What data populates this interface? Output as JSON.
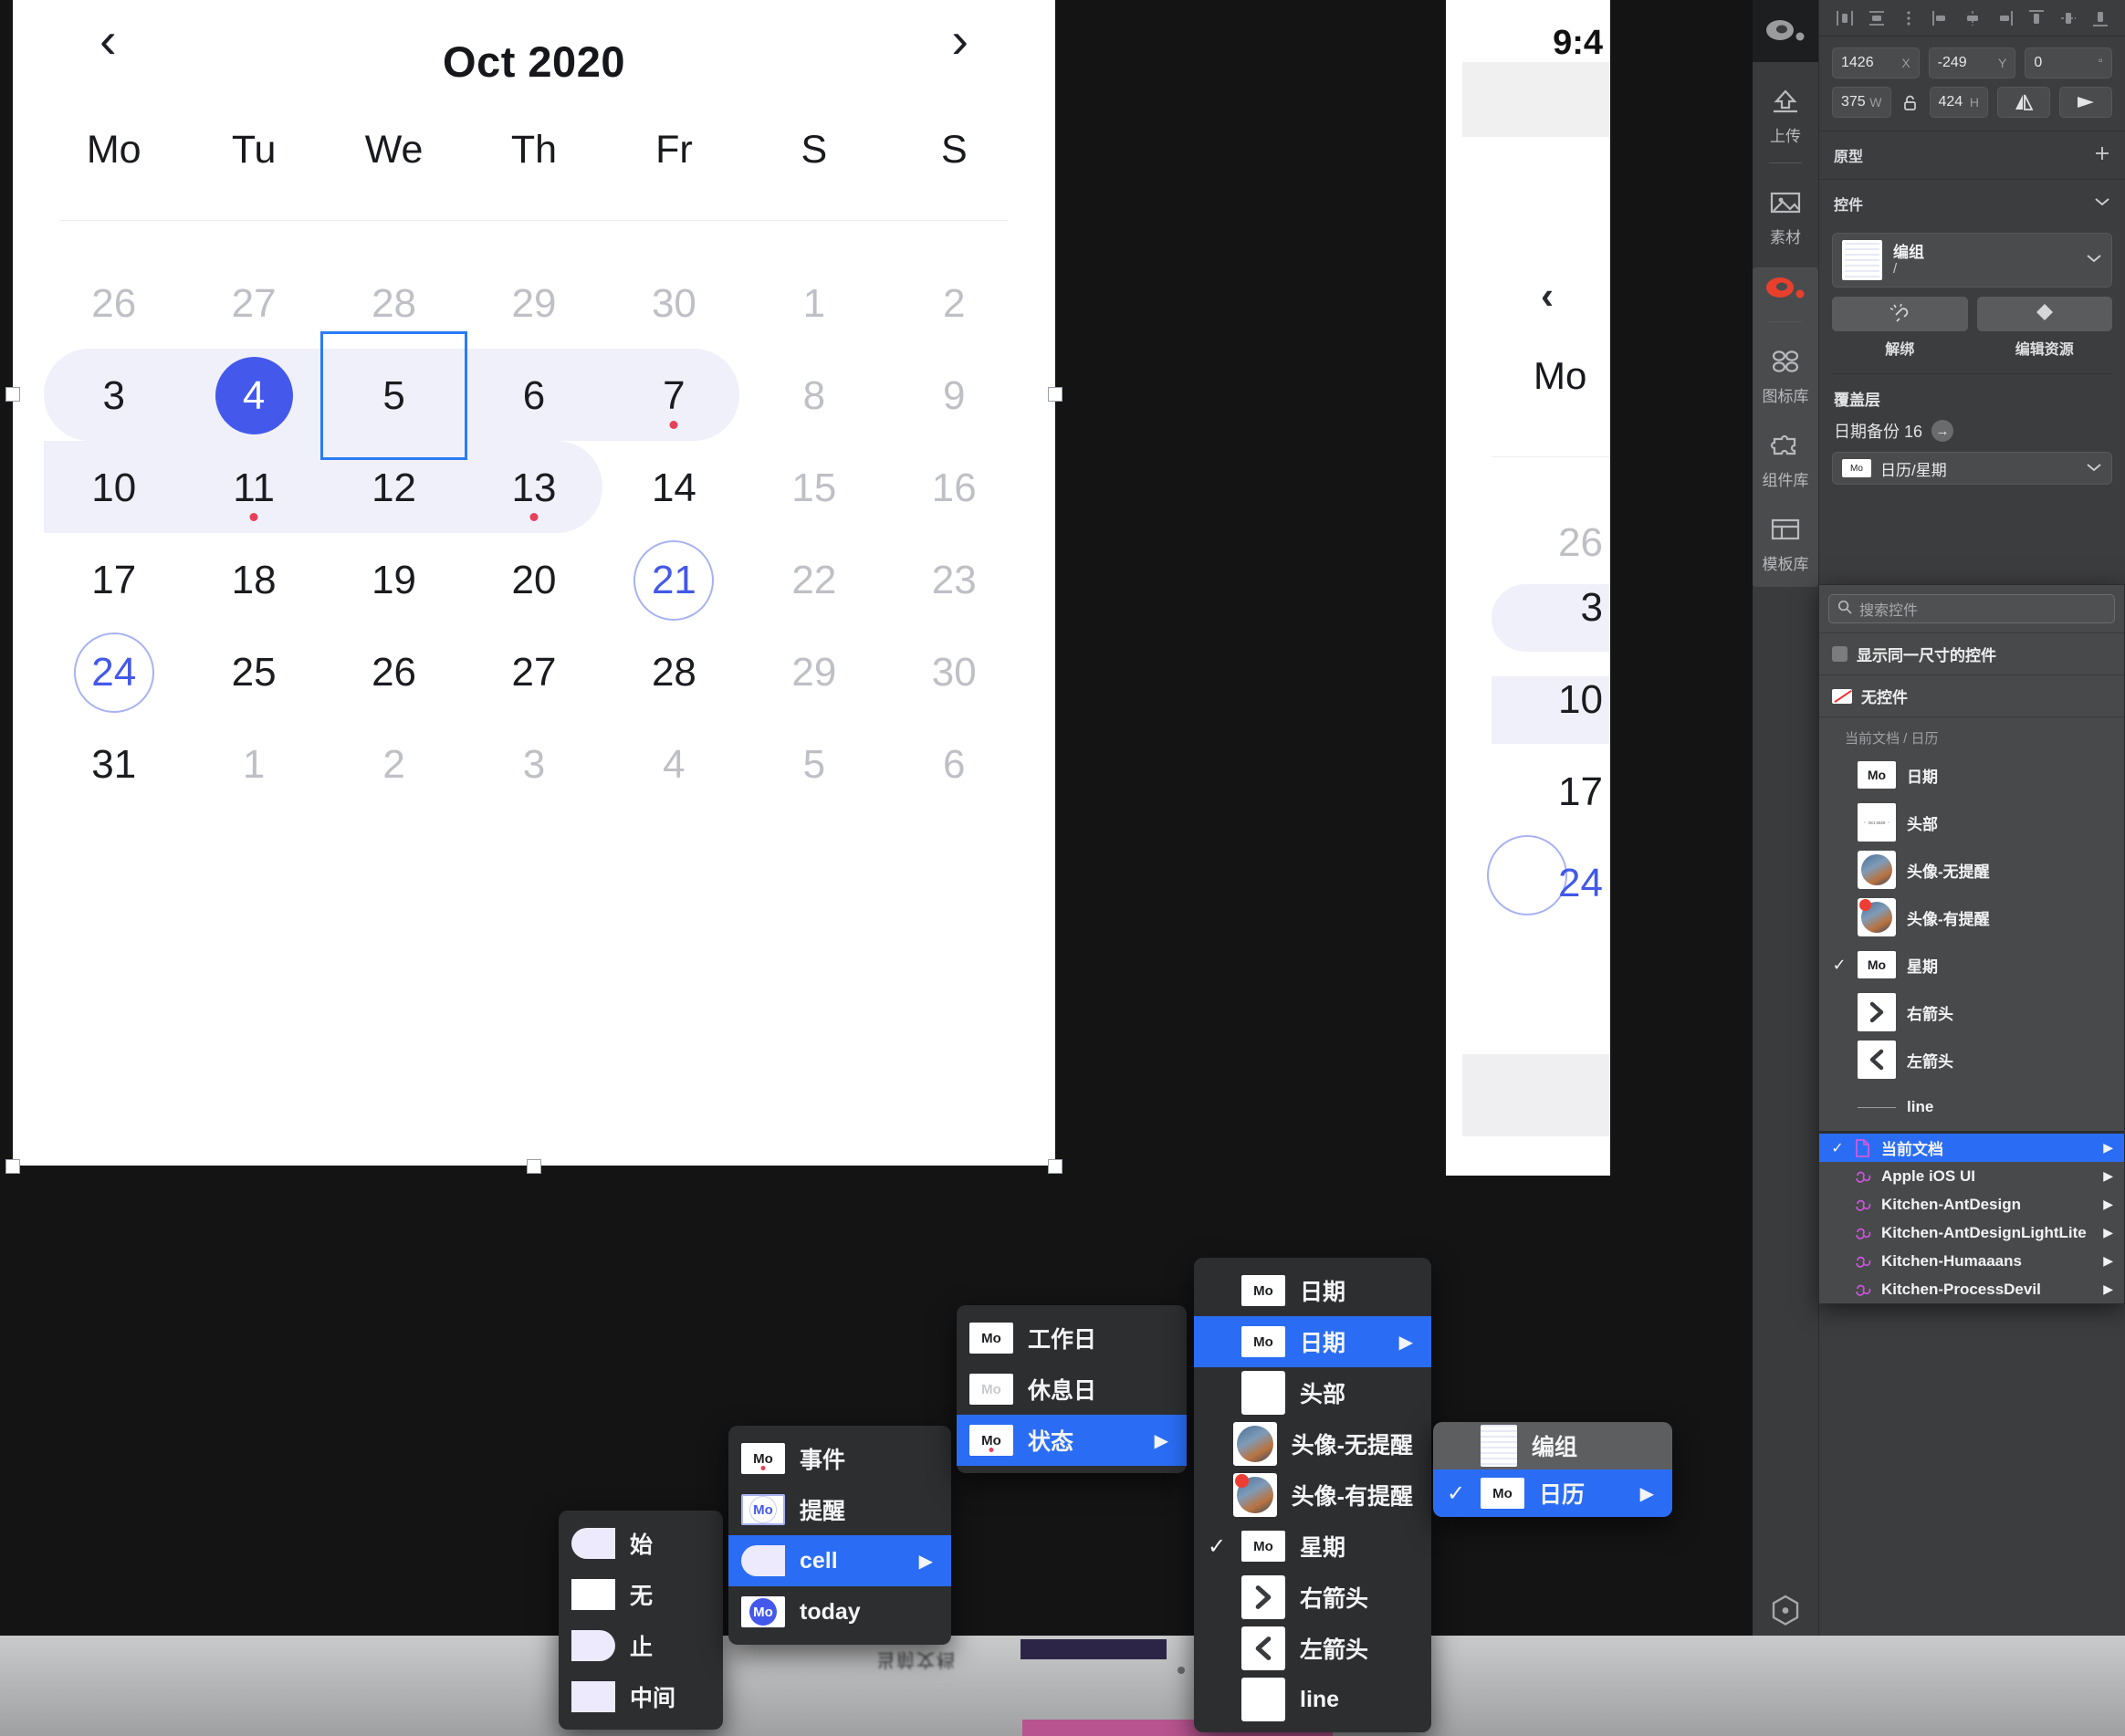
{
  "app": {
    "rail": {
      "logo_icon": "mockplus-logo-icon",
      "items": [
        {
          "label": "上传",
          "icon": "upload-icon"
        },
        {
          "label": "素材",
          "icon": "image-icon"
        },
        {
          "label": "",
          "icon": "mockplus-red-logo-icon"
        },
        {
          "label": "图标库",
          "icon": "icons-library-icon"
        },
        {
          "label": "组件库",
          "icon": "puzzle-icon"
        },
        {
          "label": "模板库",
          "icon": "template-icon"
        }
      ]
    },
    "toolbar_icons": [
      "align-left-icon",
      "align-center-horizontal-icon",
      "distribute-vertical-icon",
      "align-left-edge-icon",
      "align-center-icon",
      "align-right-edge-icon",
      "align-top-icon",
      "align-middle-icon",
      "align-bottom-icon"
    ],
    "transform": {
      "x": {
        "value": "1426",
        "unit": "X"
      },
      "y": {
        "value": "-249",
        "unit": "Y"
      },
      "rotation": {
        "value": "0",
        "unit": "°"
      },
      "w": {
        "value": "375",
        "unit": "W"
      },
      "h": {
        "value": "424",
        "unit": "H"
      },
      "lock_icon": "unlock-icon",
      "flip_h_icon": "flip-horizontal-icon",
      "flip_v_icon": "flip-vertical-icon"
    },
    "sections": {
      "prototype": {
        "title": "原型",
        "add_icon": "plus-icon"
      },
      "component": {
        "title": "控件",
        "collapse_icon": "chevron-down-icon"
      }
    },
    "component_card": {
      "name": "编组",
      "path": "/",
      "thumb_icon": "calendar-thumb-icon",
      "chevron_icon": "chevron-down-icon"
    },
    "component_buttons": [
      {
        "label": "解绑",
        "icon": "unlink-icon"
      },
      {
        "label": "编辑资源",
        "icon": "diamond-icon"
      }
    ],
    "overlay": {
      "title": "覆盖层",
      "item_label": "日期备份 16",
      "go_icon": "arrow-right-icon",
      "select_value": "日历/星期",
      "select_badge": "Mo",
      "chevron_icon": "chevron-down-icon"
    },
    "popover": {
      "search_placeholder": "搜索控件",
      "search_icon": "search-icon",
      "same_size_label": "显示同一尺寸的控件",
      "no_component_label": "无控件",
      "group_label": "当前文档 / 日历",
      "items": [
        {
          "label": "日期",
          "badge": "Mo",
          "thumb": "mo-badge",
          "checked": false
        },
        {
          "label": "头部",
          "badge": "",
          "thumb": "header-thumb",
          "checked": false
        },
        {
          "label": "头像-无提醒",
          "badge": "",
          "thumb": "avatar",
          "checked": false
        },
        {
          "label": "头像-有提醒",
          "badge": "",
          "thumb": "avatar-dot",
          "checked": false
        },
        {
          "label": "星期",
          "badge": "Mo",
          "thumb": "mo-badge",
          "checked": true
        },
        {
          "label": "右箭头",
          "badge": "",
          "thumb": "arrow-right",
          "checked": false
        },
        {
          "label": "左箭头",
          "badge": "",
          "thumb": "arrow-left",
          "checked": false
        },
        {
          "label": "line",
          "badge": "",
          "thumb": "line",
          "checked": false
        }
      ],
      "documents": [
        {
          "label": "当前文档",
          "icon": "document-icon",
          "checked": true,
          "selected": true
        },
        {
          "label": "Apple iOS UI",
          "icon": "library-icon",
          "checked": false,
          "selected": false
        },
        {
          "label": "Kitchen-AntDesign",
          "icon": "library-icon",
          "checked": false,
          "selected": false
        },
        {
          "label": "Kitchen-AntDesignLightLite",
          "icon": "library-icon",
          "checked": false,
          "selected": false
        },
        {
          "label": "Kitchen-Humaaans",
          "icon": "library-icon",
          "checked": false,
          "selected": false
        },
        {
          "label": "Kitchen-ProcessDevil",
          "icon": "library-icon",
          "checked": false,
          "selected": false
        }
      ]
    },
    "context_menus": {
      "state_menu": {
        "items": [
          {
            "label": "始",
            "shape": "pill-start"
          },
          {
            "label": "无",
            "shape": "pill-none"
          },
          {
            "label": "止",
            "shape": "pill-end"
          },
          {
            "label": "中间",
            "shape": "pill-mid"
          }
        ]
      },
      "cell_menu": {
        "items": [
          {
            "label": "事件",
            "badge": "Mo",
            "thumb": "mo-dot",
            "selected": false,
            "submenu": false
          },
          {
            "label": "提醒",
            "badge": "Mo",
            "thumb": "mo-ring",
            "selected": false,
            "submenu": false
          },
          {
            "label": "cell",
            "badge": "",
            "thumb": "pill-start",
            "selected": true,
            "submenu": true
          },
          {
            "label": "today",
            "badge": "Mo",
            "thumb": "mo-today",
            "selected": false,
            "submenu": false
          }
        ]
      },
      "day_menu": {
        "items": [
          {
            "label": "工作日",
            "badge": "Mo",
            "thumb": "mo-badge",
            "selected": false,
            "submenu": false
          },
          {
            "label": "休息日",
            "badge": "Mo",
            "thumb": "mo-gray",
            "selected": false,
            "submenu": false
          },
          {
            "label": "状态",
            "badge": "Mo",
            "thumb": "mo-dot",
            "selected": true,
            "submenu": true
          }
        ]
      },
      "date_menu": {
        "items": [
          {
            "label": "日期",
            "badge": "Mo",
            "thumb": "mo-badge",
            "selected": false,
            "submenu": false,
            "checked": false
          },
          {
            "label": "日期",
            "badge": "Mo",
            "thumb": "mo-badge",
            "selected": true,
            "submenu": true,
            "checked": false
          },
          {
            "label": "头部",
            "badge": "",
            "thumb": "header-thumb",
            "selected": false,
            "submenu": false,
            "checked": false
          },
          {
            "label": "头像-无提醒",
            "badge": "",
            "thumb": "avatar",
            "selected": false,
            "submenu": false,
            "checked": false
          },
          {
            "label": "头像-有提醒",
            "badge": "",
            "thumb": "avatar-dot",
            "selected": false,
            "submenu": false,
            "checked": false
          },
          {
            "label": "星期",
            "badge": "Mo",
            "thumb": "mo-badge",
            "selected": false,
            "submenu": false,
            "checked": true
          },
          {
            "label": "右箭头",
            "badge": "",
            "thumb": "arrow-right",
            "selected": false,
            "submenu": false,
            "checked": false
          },
          {
            "label": "左箭头",
            "badge": "",
            "thumb": "arrow-left",
            "selected": false,
            "submenu": false,
            "checked": false
          },
          {
            "label": "line",
            "badge": "",
            "thumb": "blank",
            "selected": false,
            "submenu": false,
            "checked": false
          }
        ]
      },
      "group_menu": {
        "items": [
          {
            "label": "编组",
            "thumb": "calendar-thumb",
            "selected": false,
            "submenu": false,
            "checked": false
          },
          {
            "label": "日历",
            "thumb": "mo-badge",
            "badge": "Mo",
            "selected": true,
            "submenu": true,
            "checked": true
          }
        ]
      }
    }
  },
  "calendar": {
    "title": "Oct 2020",
    "prev_icon": "chevron-left-icon",
    "next_icon": "chevron-right-icon",
    "weekdays": [
      "Mo",
      "Tu",
      "We",
      "Th",
      "Fr",
      "S",
      "S"
    ],
    "weeks": [
      [
        {
          "d": "26",
          "muted": true
        },
        {
          "d": "27",
          "muted": true
        },
        {
          "d": "28",
          "muted": true
        },
        {
          "d": "29",
          "muted": true
        },
        {
          "d": "30",
          "muted": true
        },
        {
          "d": "1",
          "muted": true
        },
        {
          "d": "2",
          "muted": true
        }
      ],
      [
        {
          "d": "3",
          "muted": false
        },
        {
          "d": "4",
          "muted": false,
          "today": true
        },
        {
          "d": "5",
          "muted": false,
          "selected": true
        },
        {
          "d": "6",
          "muted": false
        },
        {
          "d": "7",
          "muted": false,
          "dot": true
        },
        {
          "d": "8",
          "muted": true
        },
        {
          "d": "9",
          "muted": true
        }
      ],
      [
        {
          "d": "10",
          "muted": false
        },
        {
          "d": "11",
          "muted": false,
          "dot": true
        },
        {
          "d": "12",
          "muted": false
        },
        {
          "d": "13",
          "muted": false,
          "dot": true
        },
        {
          "d": "14",
          "muted": false
        },
        {
          "d": "15",
          "muted": true
        },
        {
          "d": "16",
          "muted": true
        }
      ],
      [
        {
          "d": "17",
          "muted": false
        },
        {
          "d": "18",
          "muted": false
        },
        {
          "d": "19",
          "muted": false
        },
        {
          "d": "20",
          "muted": false
        },
        {
          "d": "21",
          "muted": false,
          "ring": true
        },
        {
          "d": "22",
          "muted": true
        },
        {
          "d": "23",
          "muted": true
        }
      ],
      [
        {
          "d": "24",
          "muted": false,
          "ring": true
        },
        {
          "d": "25",
          "muted": false
        },
        {
          "d": "26",
          "muted": false
        },
        {
          "d": "27",
          "muted": false
        },
        {
          "d": "28",
          "muted": false
        },
        {
          "d": "29",
          "muted": true
        },
        {
          "d": "30",
          "muted": true
        }
      ],
      [
        {
          "d": "31",
          "muted": false
        },
        {
          "d": "1",
          "muted": true
        },
        {
          "d": "2",
          "muted": true
        },
        {
          "d": "3",
          "muted": true
        },
        {
          "d": "4",
          "muted": true
        },
        {
          "d": "5",
          "muted": true
        },
        {
          "d": "6",
          "muted": true
        }
      ]
    ]
  },
  "phone": {
    "time": "9:4",
    "prev_icon": "chevron-left-icon",
    "weekday": "Mo",
    "days": [
      "26",
      "3",
      "10",
      "17",
      "24"
    ]
  }
}
